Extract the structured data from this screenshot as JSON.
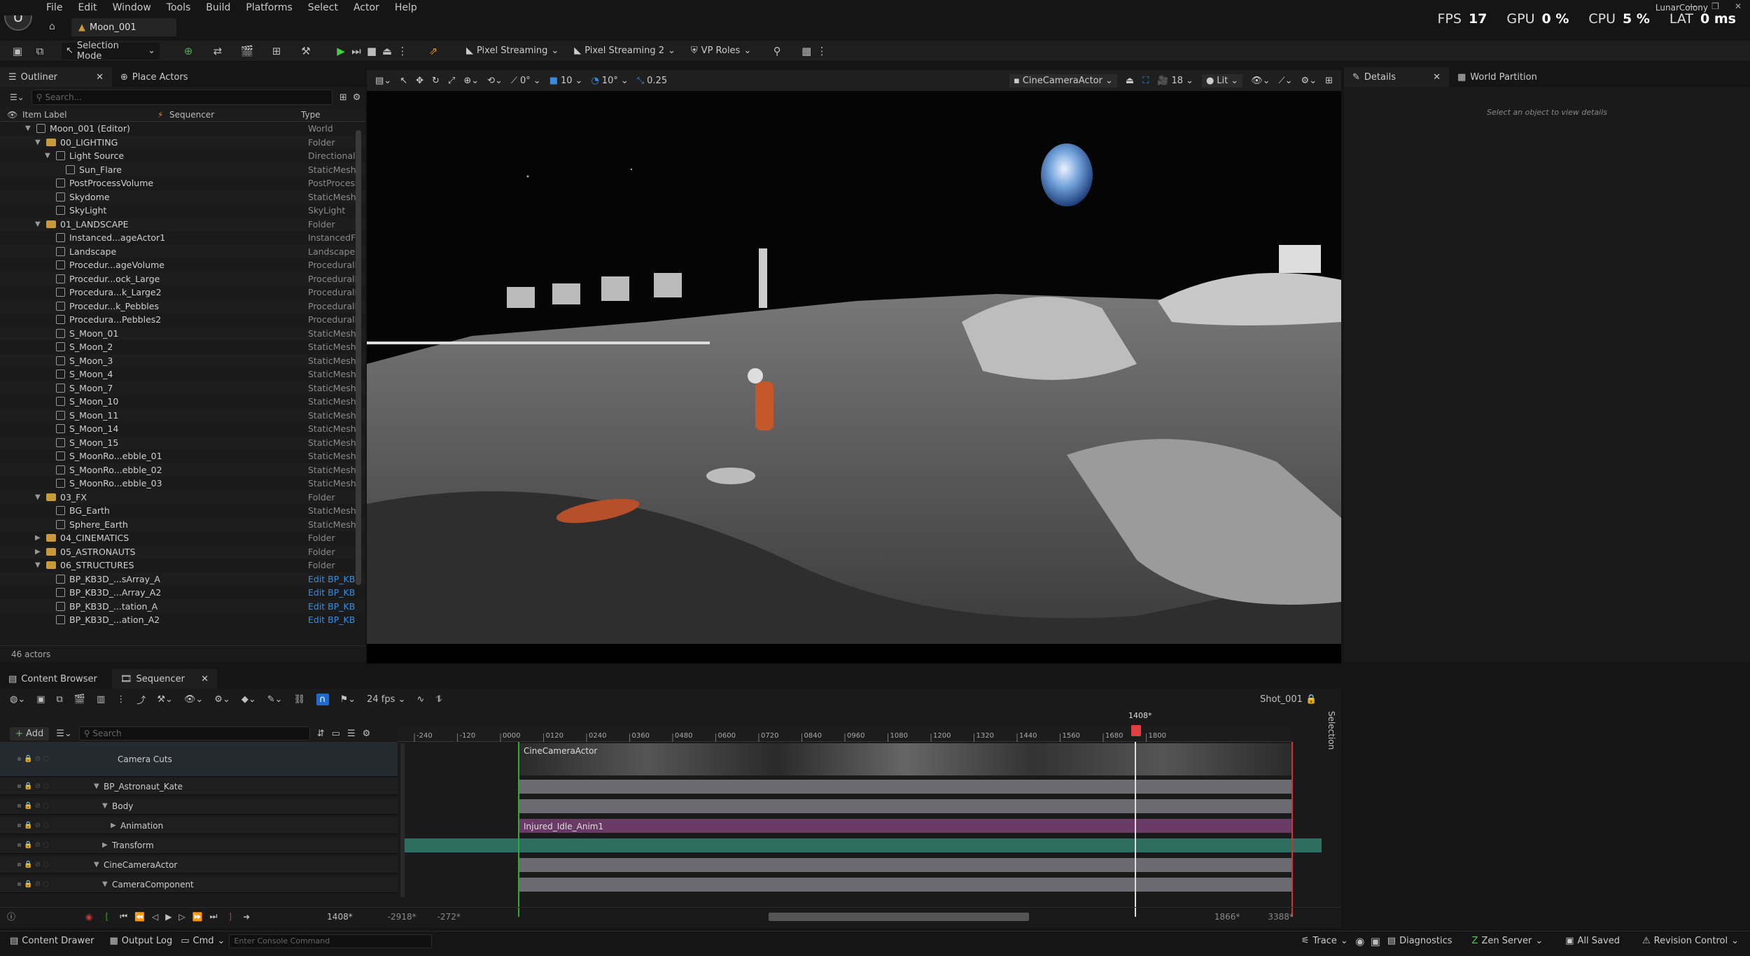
{
  "menu": [
    "File",
    "Edit",
    "Window",
    "Tools",
    "Build",
    "Platforms",
    "Select",
    "Actor",
    "Help"
  ],
  "doc_tab": "Moon_001",
  "project": "LunarColony",
  "stats": {
    "fps_label": "FPS",
    "fps": "17",
    "gpu_label": "GPU",
    "gpu": "0 %",
    "cpu_label": "CPU",
    "cpu": "5 %",
    "lat_label": "LAT",
    "lat": "0 ms"
  },
  "toolbar": {
    "selection_mode": "Selection Mode",
    "pixel_streaming": "Pixel Streaming",
    "pixel_streaming2": "Pixel Streaming 2",
    "vp_roles": "VP Roles"
  },
  "outliner": {
    "tab": "Outliner",
    "tab2": "Place Actors",
    "search": "Search...",
    "col_label": "Item Label",
    "col_seq": "Sequencer",
    "col_type": "Type",
    "rows": [
      {
        "label": "Moon_001 (Editor)",
        "type": "World",
        "indent": 0,
        "kind": "world",
        "arrow": "▼"
      },
      {
        "label": "00_LIGHTING",
        "type": "Folder",
        "indent": 1,
        "kind": "folder",
        "arrow": "▼"
      },
      {
        "label": "Light Source",
        "type": "DirectionalL",
        "indent": 2,
        "kind": "obj",
        "arrow": "▼"
      },
      {
        "label": "Sun_Flare",
        "type": "StaticMesh/",
        "indent": 3,
        "kind": "obj",
        "arrow": ""
      },
      {
        "label": "PostProcessVolume",
        "type": "PostProcess",
        "indent": 2,
        "kind": "obj",
        "arrow": ""
      },
      {
        "label": "Skydome",
        "type": "StaticMesh/",
        "indent": 2,
        "kind": "obj",
        "arrow": ""
      },
      {
        "label": "SkyLight",
        "type": "SkyLight",
        "indent": 2,
        "kind": "obj",
        "arrow": ""
      },
      {
        "label": "01_LANDSCAPE",
        "type": "Folder",
        "indent": 1,
        "kind": "folder",
        "arrow": "▼"
      },
      {
        "label": "Instanced...ageActor1",
        "type": "InstancedFo",
        "indent": 2,
        "kind": "obj",
        "arrow": ""
      },
      {
        "label": "Landscape",
        "type": "Landscape",
        "indent": 2,
        "kind": "obj",
        "arrow": ""
      },
      {
        "label": "Procedur...ageVolume",
        "type": "ProceduralF",
        "indent": 2,
        "kind": "obj",
        "arrow": ""
      },
      {
        "label": "Procedur...ock_Large",
        "type": "ProceduralF",
        "indent": 2,
        "kind": "obj",
        "arrow": ""
      },
      {
        "label": "Procedura...k_Large2",
        "type": "ProceduralF",
        "indent": 2,
        "kind": "obj",
        "arrow": ""
      },
      {
        "label": "Procedur...k_Pebbles",
        "type": "ProceduralF",
        "indent": 2,
        "kind": "obj",
        "arrow": ""
      },
      {
        "label": "Procedura...Pebbles2",
        "type": "ProceduralF",
        "indent": 2,
        "kind": "obj",
        "arrow": ""
      },
      {
        "label": "S_Moon_01",
        "type": "StaticMesh/",
        "indent": 2,
        "kind": "obj",
        "arrow": ""
      },
      {
        "label": "S_Moon_2",
        "type": "StaticMesh/",
        "indent": 2,
        "kind": "obj",
        "arrow": ""
      },
      {
        "label": "S_Moon_3",
        "type": "StaticMesh/",
        "indent": 2,
        "kind": "obj",
        "arrow": ""
      },
      {
        "label": "S_Moon_4",
        "type": "StaticMesh/",
        "indent": 2,
        "kind": "obj",
        "arrow": ""
      },
      {
        "label": "S_Moon_7",
        "type": "StaticMesh/",
        "indent": 2,
        "kind": "obj",
        "arrow": ""
      },
      {
        "label": "S_Moon_10",
        "type": "StaticMesh/",
        "indent": 2,
        "kind": "obj",
        "arrow": ""
      },
      {
        "label": "S_Moon_11",
        "type": "StaticMesh/",
        "indent": 2,
        "kind": "obj",
        "arrow": ""
      },
      {
        "label": "S_Moon_14",
        "type": "StaticMesh/",
        "indent": 2,
        "kind": "obj",
        "arrow": ""
      },
      {
        "label": "S_Moon_15",
        "type": "StaticMesh/",
        "indent": 2,
        "kind": "obj",
        "arrow": ""
      },
      {
        "label": "S_MoonRo...ebble_01",
        "type": "StaticMesh/",
        "indent": 2,
        "kind": "obj",
        "arrow": ""
      },
      {
        "label": "S_MoonRo...ebble_02",
        "type": "StaticMesh/",
        "indent": 2,
        "kind": "obj",
        "arrow": ""
      },
      {
        "label": "S_MoonRo...ebble_03",
        "type": "StaticMesh/",
        "indent": 2,
        "kind": "obj",
        "arrow": ""
      },
      {
        "label": "03_FX",
        "type": "Folder",
        "indent": 1,
        "kind": "folder",
        "arrow": "▼"
      },
      {
        "label": "BG_Earth",
        "type": "StaticMesh/",
        "indent": 2,
        "kind": "obj",
        "arrow": ""
      },
      {
        "label": "Sphere_Earth",
        "type": "StaticMesh/",
        "indent": 2,
        "kind": "obj",
        "arrow": ""
      },
      {
        "label": "04_CINEMATICS",
        "type": "Folder",
        "indent": 1,
        "kind": "folder",
        "arrow": "▶"
      },
      {
        "label": "05_ASTRONAUTS",
        "type": "Folder",
        "indent": 1,
        "kind": "folder",
        "arrow": "▶"
      },
      {
        "label": "06_STRUCTURES",
        "type": "Folder",
        "indent": 1,
        "kind": "folder",
        "arrow": "▼"
      },
      {
        "label": "BP_KB3D_...sArray_A",
        "type": "Edit BP_KB:",
        "indent": 2,
        "kind": "obj",
        "arrow": "",
        "link": true
      },
      {
        "label": "BP_KB3D_...Array_A2",
        "type": "Edit BP_KB:",
        "indent": 2,
        "kind": "obj",
        "arrow": "",
        "link": true
      },
      {
        "label": "BP_KB3D_...tation_A",
        "type": "Edit BP_KB:",
        "indent": 2,
        "kind": "obj",
        "arrow": "",
        "link": true
      },
      {
        "label": "BP_KB3D_...ation_A2",
        "type": "Edit BP_KB:",
        "indent": 2,
        "kind": "obj",
        "arrow": "",
        "link": true
      }
    ],
    "actor_count": "46 actors"
  },
  "viewport": {
    "camera": "CineCameraActor",
    "lit": "Lit",
    "snap_move": "10",
    "snap_rot": "10°",
    "snap_scale": "0.25",
    "angle": "0°",
    "speed": "18"
  },
  "details": {
    "tab": "Details",
    "tab2": "World Partition",
    "empty": "Select an object to view details"
  },
  "sequencer": {
    "tab1": "Content Browser",
    "tab2": "Sequencer",
    "fps": "24 fps",
    "shot": "Shot_001",
    "add": "Add",
    "search": "Search",
    "playhead": "1408*",
    "ticks": [
      "-240",
      "-120",
      "0000",
      "0120",
      "0240",
      "0360",
      "0480",
      "0600",
      "0720",
      "0840",
      "0960",
      "1080",
      "1200",
      "1320",
      "1440",
      "1560",
      "1680",
      "1800"
    ],
    "tracks": [
      {
        "label": "Camera Cuts",
        "indent": 0,
        "arrow": ""
      },
      {
        "label": "BP_Astronaut_Kate",
        "indent": 0,
        "arrow": "▼"
      },
      {
        "label": "Body",
        "indent": 1,
        "arrow": "▼"
      },
      {
        "label": "Animation",
        "indent": 2,
        "arrow": "▶"
      },
      {
        "label": "Transform",
        "indent": 1,
        "arrow": "▶"
      },
      {
        "label": "CineCameraActor",
        "indent": 0,
        "arrow": "▼"
      },
      {
        "label": "CameraComponent",
        "indent": 1,
        "arrow": "▼"
      }
    ],
    "clip_camera": "CineCameraActor",
    "clip_anim": "Injured_Idle_Anim1",
    "selection": "Selection",
    "bottom": {
      "frame": "1408*",
      "start_out": "-2918*",
      "start_in": "-272*",
      "end_in": "1866*",
      "end_out": "3388*"
    }
  },
  "status": {
    "content_drawer": "Content Drawer",
    "output_log": "Output Log",
    "cmd": "Cmd",
    "console": "Enter Console Command",
    "trace": "Trace",
    "diagnostics": "Diagnostics",
    "zen": "Zen Server",
    "saved": "All Saved",
    "revision": "Revision Control"
  },
  "colors": {
    "accent": "#3a8dde",
    "anim": "#6a3a66",
    "transform": "#2e6e60",
    "playhead": "#e04040",
    "folder": "#c99a3a"
  }
}
